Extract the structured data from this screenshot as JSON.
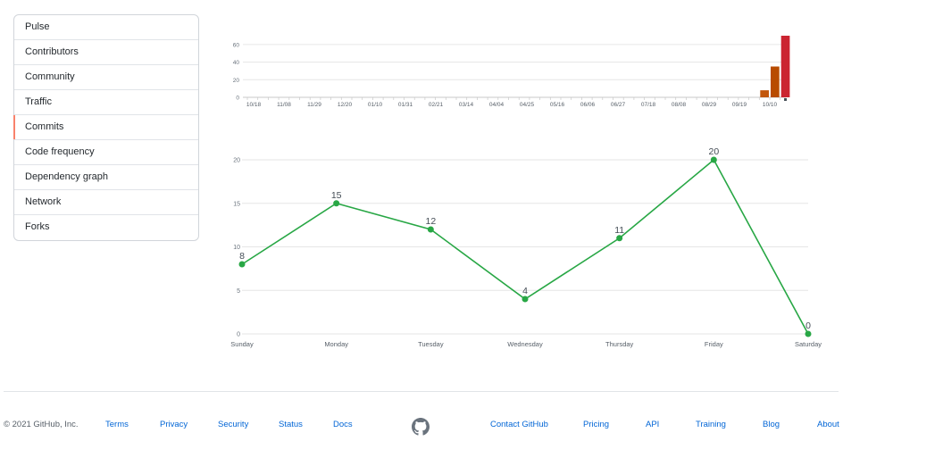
{
  "sidebar": {
    "items": [
      {
        "label": "Pulse"
      },
      {
        "label": "Contributors"
      },
      {
        "label": "Community"
      },
      {
        "label": "Traffic"
      },
      {
        "label": "Commits",
        "selected": true
      },
      {
        "label": "Code frequency"
      },
      {
        "label": "Dependency graph"
      },
      {
        "label": "Network"
      },
      {
        "label": "Forks"
      }
    ],
    "selected_color": "#f9826c"
  },
  "chart_data": [
    {
      "type": "bar",
      "categories": [
        "10/18",
        "11/08",
        "11/29",
        "12/20",
        "01/10",
        "01/31",
        "02/21",
        "03/14",
        "04/04",
        "04/25",
        "05/16",
        "06/06",
        "06/27",
        "07/18",
        "08/08",
        "08/29",
        "09/19",
        "10/10"
      ],
      "values": [
        0,
        0,
        0,
        0,
        0,
        0,
        0,
        0,
        0,
        0,
        0,
        0,
        0,
        0,
        0,
        0,
        0,
        0,
        0,
        0,
        0,
        0,
        0,
        0,
        0,
        0,
        0,
        0,
        0,
        0,
        0,
        0,
        0,
        0,
        0,
        0,
        0,
        0,
        0,
        0,
        0,
        0,
        0,
        0,
        0,
        0,
        0,
        0,
        0,
        8,
        35,
        70
      ],
      "ylim": [
        0,
        70
      ],
      "yticks": [
        0,
        20,
        40,
        60
      ],
      "grid": true,
      "colors": [
        "#c2570c",
        "#b84c00",
        "#cb2431"
      ]
    },
    {
      "type": "line",
      "categories": [
        "Sunday",
        "Monday",
        "Tuesday",
        "Wednesday",
        "Thursday",
        "Friday",
        "Saturday"
      ],
      "values": [
        8,
        15,
        12,
        4,
        11,
        20,
        0
      ],
      "ylim": [
        0,
        20
      ],
      "yticks": [
        0,
        5,
        10,
        15,
        20
      ],
      "grid": true,
      "color": "#28a745",
      "data_labels": true
    }
  ],
  "footer": {
    "copyright": "© 2021 GitHub, Inc.",
    "links": [
      "Terms",
      "Privacy",
      "Security",
      "Status",
      "Docs"
    ],
    "links_right": [
      "Contact GitHub",
      "Pricing",
      "API",
      "Training",
      "Blog",
      "About"
    ],
    "logo_icon": "github-mark-icon"
  }
}
